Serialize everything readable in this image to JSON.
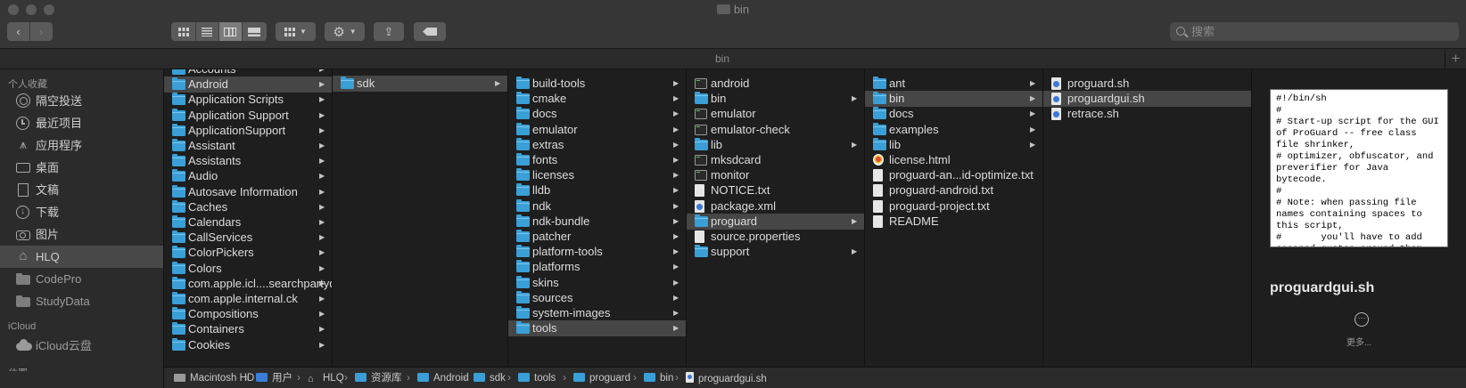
{
  "window": {
    "title": "bin",
    "tab_title": "bin",
    "new_tab_symbol": "+",
    "search_placeholder": "搜索"
  },
  "sidebar": {
    "favorites_header": "个人收藏",
    "favorites": [
      {
        "label": "隔空投送",
        "icon": "airdrop-icon"
      },
      {
        "label": "最近项目",
        "icon": "clock-icon"
      },
      {
        "label": "应用程序",
        "icon": "apps-icon"
      },
      {
        "label": "桌面",
        "icon": "desktop-icon"
      },
      {
        "label": "文稿",
        "icon": "document-icon"
      },
      {
        "label": "下载",
        "icon": "download-icon"
      },
      {
        "label": "图片",
        "icon": "camera-icon"
      },
      {
        "label": "HLQ",
        "icon": "home-icon",
        "selected": true
      },
      {
        "label": "CodePro",
        "icon": "folder-icon"
      },
      {
        "label": "StudyData",
        "icon": "folder-icon"
      }
    ],
    "icloud_header": "iCloud",
    "icloud": [
      {
        "label": "iCloud云盘",
        "icon": "cloud-icon"
      }
    ],
    "tags_header": "位置"
  },
  "columns": [
    {
      "items": [
        {
          "label": "Accounts",
          "type": "folder",
          "arrow": true
        },
        {
          "label": "Android",
          "type": "folder",
          "arrow": true,
          "selected": true
        },
        {
          "label": "Application Scripts",
          "type": "folder",
          "arrow": true
        },
        {
          "label": "Application Support",
          "type": "folder",
          "arrow": true
        },
        {
          "label": "ApplicationSupport",
          "type": "folder",
          "arrow": true
        },
        {
          "label": "Assistant",
          "type": "folder",
          "arrow": true
        },
        {
          "label": "Assistants",
          "type": "folder",
          "arrow": true
        },
        {
          "label": "Audio",
          "type": "folder",
          "arrow": true
        },
        {
          "label": "Autosave Information",
          "type": "folder",
          "arrow": true
        },
        {
          "label": "Caches",
          "type": "folder",
          "arrow": true
        },
        {
          "label": "Calendars",
          "type": "folder",
          "arrow": true
        },
        {
          "label": "CallServices",
          "type": "folder",
          "arrow": true
        },
        {
          "label": "ColorPickers",
          "type": "folder",
          "arrow": true
        },
        {
          "label": "Colors",
          "type": "folder",
          "arrow": true
        },
        {
          "label": "com.apple.icl....searchpartyd",
          "type": "folder",
          "arrow": true
        },
        {
          "label": "com.apple.internal.ck",
          "type": "folder",
          "arrow": true
        },
        {
          "label": "Compositions",
          "type": "folder",
          "arrow": true
        },
        {
          "label": "Containers",
          "type": "folder",
          "arrow": true
        },
        {
          "label": "Cookies",
          "type": "folder",
          "arrow": true
        }
      ]
    },
    {
      "items": [
        {
          "label": "sdk",
          "type": "folder",
          "arrow": true,
          "selected": true
        }
      ]
    },
    {
      "items": [
        {
          "label": "build-tools",
          "type": "folder",
          "arrow": true
        },
        {
          "label": "cmake",
          "type": "folder",
          "arrow": true
        },
        {
          "label": "docs",
          "type": "folder",
          "arrow": true
        },
        {
          "label": "emulator",
          "type": "folder",
          "arrow": true
        },
        {
          "label": "extras",
          "type": "folder",
          "arrow": true
        },
        {
          "label": "fonts",
          "type": "folder",
          "arrow": true
        },
        {
          "label": "licenses",
          "type": "folder",
          "arrow": true
        },
        {
          "label": "lldb",
          "type": "folder",
          "arrow": true
        },
        {
          "label": "ndk",
          "type": "folder",
          "arrow": true
        },
        {
          "label": "ndk-bundle",
          "type": "folder",
          "arrow": true
        },
        {
          "label": "patcher",
          "type": "folder",
          "arrow": true
        },
        {
          "label": "platform-tools",
          "type": "folder",
          "arrow": true
        },
        {
          "label": "platforms",
          "type": "folder",
          "arrow": true
        },
        {
          "label": "skins",
          "type": "folder",
          "arrow": true
        },
        {
          "label": "sources",
          "type": "folder",
          "arrow": true
        },
        {
          "label": "system-images",
          "type": "folder",
          "arrow": true
        },
        {
          "label": "tools",
          "type": "folder",
          "arrow": true,
          "selected": true
        }
      ]
    },
    {
      "items": [
        {
          "label": "android",
          "type": "exec",
          "arrow": false
        },
        {
          "label": "bin",
          "type": "folder",
          "arrow": true
        },
        {
          "label": "emulator",
          "type": "exec",
          "arrow": false
        },
        {
          "label": "emulator-check",
          "type": "exec",
          "arrow": false
        },
        {
          "label": "lib",
          "type": "folder",
          "arrow": true
        },
        {
          "label": "mksdcard",
          "type": "exec",
          "arrow": false
        },
        {
          "label": "monitor",
          "type": "exec",
          "arrow": false
        },
        {
          "label": "NOTICE.txt",
          "type": "file",
          "arrow": false
        },
        {
          "label": "package.xml",
          "type": "script",
          "arrow": false
        },
        {
          "label": "proguard",
          "type": "folder",
          "arrow": true,
          "selected": true
        },
        {
          "label": "source.properties",
          "type": "file",
          "arrow": false
        },
        {
          "label": "support",
          "type": "folder",
          "arrow": true
        }
      ]
    },
    {
      "items": [
        {
          "label": "ant",
          "type": "folder",
          "arrow": true
        },
        {
          "label": "bin",
          "type": "folder",
          "arrow": true,
          "selected": true
        },
        {
          "label": "docs",
          "type": "folder",
          "arrow": true
        },
        {
          "label": "examples",
          "type": "folder",
          "arrow": true
        },
        {
          "label": "lib",
          "type": "folder",
          "arrow": true
        },
        {
          "label": "license.html",
          "type": "html",
          "arrow": false
        },
        {
          "label": "proguard-an...id-optimize.txt",
          "type": "file",
          "arrow": false
        },
        {
          "label": "proguard-android.txt",
          "type": "file",
          "arrow": false
        },
        {
          "label": "proguard-project.txt",
          "type": "file",
          "arrow": false
        },
        {
          "label": "README",
          "type": "file",
          "arrow": false
        }
      ]
    },
    {
      "items": [
        {
          "label": "proguard.sh",
          "type": "script",
          "arrow": false
        },
        {
          "label": "proguardgui.sh",
          "type": "script",
          "arrow": false,
          "selected": true
        },
        {
          "label": "retrace.sh",
          "type": "script",
          "arrow": false
        }
      ]
    }
  ],
  "preview": {
    "code": "#!/bin/sh\n#\n# Start-up script for the GUI of ProGuard -- free class file shrinker,\n# optimizer, obfuscator, and preverifier for Java bytecode.\n#\n# Note: when passing file names containing spaces to this script,\n#       you'll have to add escaped quotes around them,",
    "filename": "proguardgui.sh",
    "more_label": "更多...",
    "more_icon": "ellipsis-circle-icon"
  },
  "pathbar": [
    {
      "label": "Macintosh HD",
      "icon": "disk-icon"
    },
    {
      "label": "用户",
      "icon": "users-folder-icon"
    },
    {
      "label": "HLQ",
      "icon": "home-icon"
    },
    {
      "label": "资源库",
      "icon": "folder-icon"
    },
    {
      "label": "Android",
      "icon": "folder-icon"
    },
    {
      "label": "sdk",
      "icon": "folder-icon"
    },
    {
      "label": "tools",
      "icon": "folder-icon"
    },
    {
      "label": "proguard",
      "icon": "folder-icon"
    },
    {
      "label": "bin",
      "icon": "folder-icon"
    },
    {
      "label": "proguardgui.sh",
      "icon": "script-file-icon"
    }
  ],
  "colors": {
    "folder": "#3a9fd6",
    "selection": "#464646",
    "sidebar_selection": "#484848"
  }
}
